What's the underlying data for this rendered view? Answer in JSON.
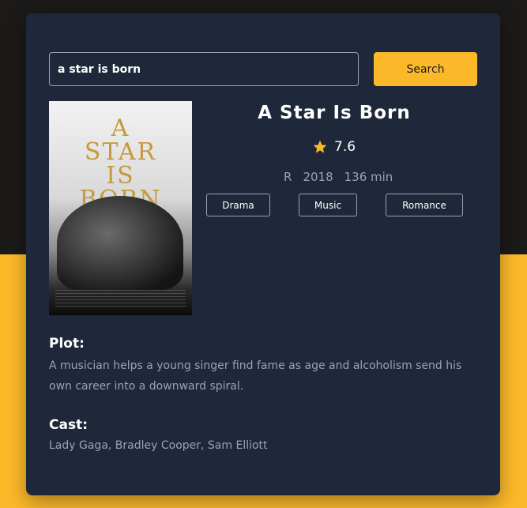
{
  "search": {
    "value": "a star is born",
    "button_label": "Search"
  },
  "movie": {
    "title": "A Star Is Born",
    "rating": "7.6",
    "rated": "R",
    "year": "2018",
    "runtime": "136 min",
    "genres": [
      "Drama",
      "Music",
      "Romance"
    ],
    "poster": {
      "title_lines": [
        "A",
        "STAR",
        "IS",
        "BORN"
      ]
    },
    "plot_label": "Plot:",
    "plot": "A musician helps a young singer find fame as age and alcoholism send his own career into a downward spiral.",
    "cast_label": "Cast:",
    "cast": "Lady Gaga, Bradley Cooper, Sam Elliott"
  },
  "colors": {
    "accent": "#fbb92a",
    "card": "#1e283a",
    "page_top": "#1c1a18",
    "muted_text": "#9aa3b3"
  },
  "icons": {
    "rating": "star-icon"
  }
}
